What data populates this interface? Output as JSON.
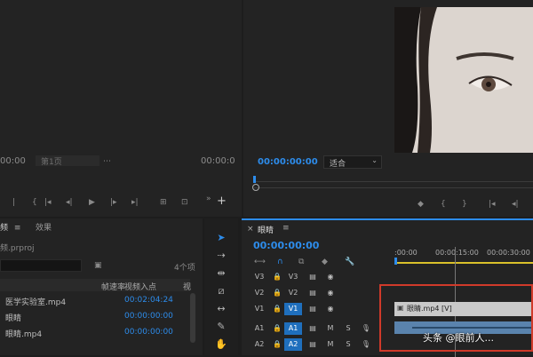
{
  "source": {
    "timecode_left": "00:00",
    "fit_label": "第1页",
    "timecode_right": "00:00:0"
  },
  "program": {
    "timecode": "00:00:00:00",
    "fit_select": "适合",
    "colors": {
      "accent": "#2d8ceb",
      "bg": "#1d1d1d",
      "panel": "#232323"
    }
  },
  "project": {
    "tabs": [
      "频",
      "效果"
    ],
    "file": "频.prproj",
    "item_count": "4个项",
    "columns": [
      "帧速率",
      "视频入点",
      "视"
    ],
    "items": [
      {
        "name": "医学实验室.mp4",
        "in": "00:02:04:24"
      },
      {
        "name": "眼睛",
        "in": "00:00:00:00"
      },
      {
        "name": "眼睛.mp4",
        "in": "00:00:00:00"
      }
    ]
  },
  "timeline": {
    "title": "眼睛",
    "timecode": "00:00:00:00",
    "ruler": [
      ":00:00",
      "00:00:15:00",
      "00:00:30:00"
    ],
    "video_tracks": [
      "V3",
      "V2",
      "V1"
    ],
    "audio_tracks": [
      "A1",
      "A2"
    ],
    "clip_label": "眼睛.mp4 [V]"
  },
  "watermark": "头条 @眼前人..."
}
